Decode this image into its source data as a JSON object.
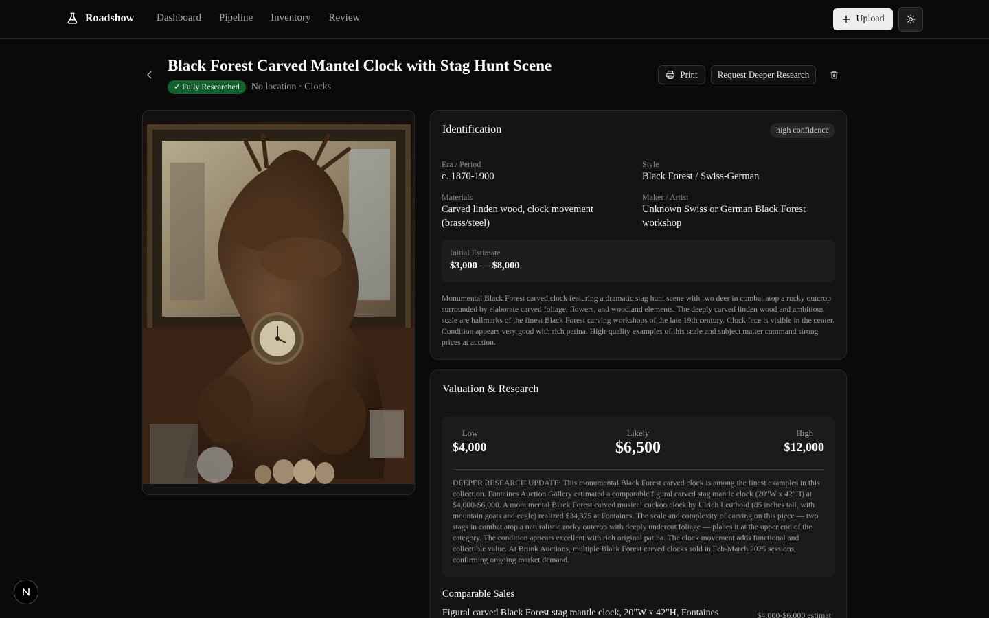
{
  "app": {
    "name": "Roadshow",
    "nav": [
      "Dashboard",
      "Pipeline",
      "Inventory",
      "Review"
    ],
    "upload_label": "Upload"
  },
  "item": {
    "title": "Black Forest Carved Mantel Clock with Stag Hunt Scene",
    "status_badge": "Fully Researched",
    "meta": "No location · Clocks",
    "actions": {
      "print": "Print",
      "request_research": "Request Deeper Research"
    }
  },
  "identification": {
    "title": "Identification",
    "confidence": "high confidence",
    "era_label": "Era / Period",
    "era": "c. 1870-1900",
    "style_label": "Style",
    "style": "Black Forest / Swiss-German",
    "materials_label": "Materials",
    "materials": "Carved linden wood, clock movement (brass/steel)",
    "maker_label": "Maker / Artist",
    "maker": "Unknown Swiss or German Black Forest workshop",
    "estimate_label": "Initial Estimate",
    "estimate": "$3,000 — $8,000",
    "description": "Monumental Black Forest carved clock featuring a dramatic stag hunt scene with two deer in combat atop a rocky outcrop surrounded by elaborate carved foliage, flowers, and woodland elements. The deeply carved linden wood and ambitious scale are hallmarks of the finest Black Forest carving workshops of the late 19th century. Clock face is visible in the center. Condition appears very good with rich patina. High-quality examples of this scale and subject matter command strong prices at auction."
  },
  "valuation": {
    "title": "Valuation & Research",
    "low_label": "Low",
    "low": "$4,000",
    "likely_label": "Likely",
    "likely": "$6,500",
    "high_label": "High",
    "high": "$12,000",
    "research": "DEEPER RESEARCH UPDATE: This monumental Black Forest carved clock is among the finest examples in this collection. Fontaines Auction Gallery estimated a comparable figural carved stag mantle clock (20\"W x 42\"H) at $4,000-$6,000. A monumental Black Forest carved musical cuckoo clock by Ulrich Leuthold (85 inches tall, with mountain goats and eagle) realized $34,375 at Fontaines. The scale and complexity of carving on this piece — two stags in combat atop a naturalistic rocky outcrop with deeply undercut foliage — places it at the upper end of the category. The condition appears excellent with rich original patina. The clock movement adds functional and collectible value. At Brunk Auctions, multiple Black Forest carved clocks sold in Feb-March 2025 sessions, confirming ongoing market demand.",
    "comps_title": "Comparable Sales",
    "comps": [
      {
        "desc": "Figural carved Black Forest stag mantle clock, 20\"W x 42\"H, Fontaines",
        "price": "$4,000-$6,000 estimat"
      }
    ]
  },
  "image": {
    "alt": "Black Forest carved mantel clock photo"
  },
  "colors": {
    "accent_green": "#15602f",
    "background": "#0a0a0a",
    "card": "#141414"
  }
}
